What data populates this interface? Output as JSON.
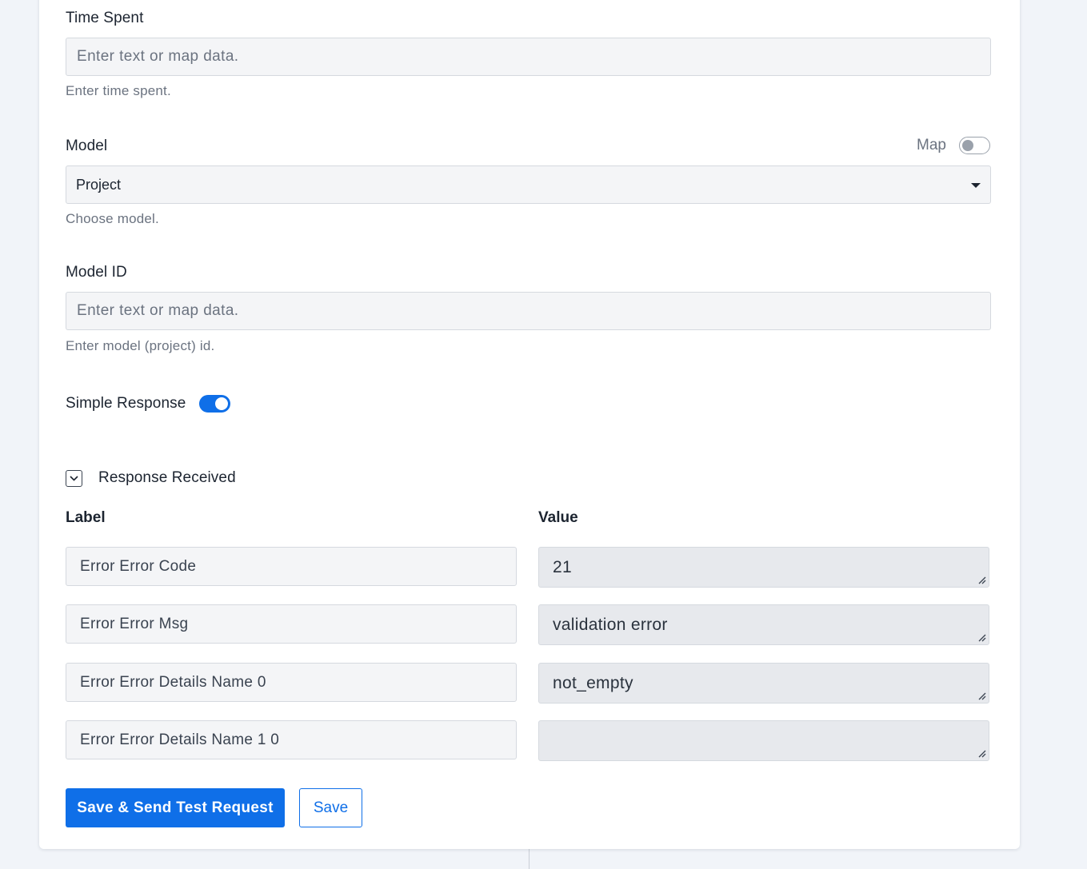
{
  "time_spent": {
    "label": "Time Spent",
    "placeholder": "Enter text or map data.",
    "help": "Enter time spent."
  },
  "model": {
    "label": "Model",
    "map_label": "Map",
    "map_enabled": false,
    "selected": "Project",
    "help": "Choose model."
  },
  "model_id": {
    "label": "Model ID",
    "placeholder": "Enter text or map data.",
    "help": "Enter model (project) id."
  },
  "simple_response": {
    "label": "Simple Response",
    "enabled": true
  },
  "response": {
    "title": "Response Received",
    "label_header": "Label",
    "value_header": "Value",
    "rows": [
      {
        "label": "Error Error Code",
        "value": "21"
      },
      {
        "label": "Error Error Msg",
        "value": "validation error"
      },
      {
        "label": "Error Error Details Name 0",
        "value": "not_empty"
      },
      {
        "label": "Error Error Details Name 1 0",
        "value": ""
      }
    ]
  },
  "actions": {
    "save_send_label": "Save & Send Test Request",
    "save_label": "Save"
  },
  "colors": {
    "accent": "#0f6fe8",
    "background": "#f1f4f9"
  }
}
